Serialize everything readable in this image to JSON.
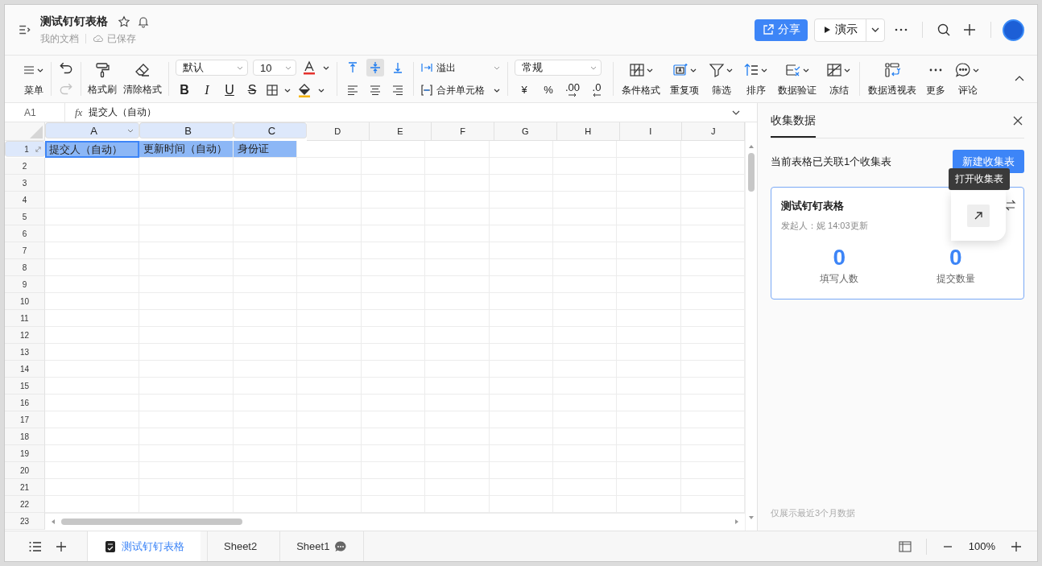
{
  "header": {
    "title": "测试钉钉表格",
    "location": "我的文档",
    "save_status": "已保存",
    "share": "分享",
    "present": "演示"
  },
  "toolbar": {
    "menu": "菜单",
    "history": [
      {
        "kind": "undo",
        "disabled": false
      },
      {
        "kind": "redo",
        "disabled": true
      }
    ],
    "format_painter": "格式刷",
    "clear_format": "清除格式",
    "font": "默认",
    "font_size": "10",
    "text_styles": [
      {
        "kind": "bold",
        "label": "B"
      },
      {
        "kind": "italic",
        "label": "I"
      },
      {
        "kind": "underline",
        "label": "U"
      },
      {
        "kind": "strike",
        "label": "S"
      }
    ],
    "vertical_align": [
      {
        "kind": "top",
        "selected": false
      },
      {
        "kind": "middle",
        "selected": true
      },
      {
        "kind": "bottom",
        "selected": false
      }
    ],
    "overflow": "溢出",
    "merge": "合并单元格",
    "number_format": "常规",
    "number_buttons": [
      {
        "kind": "plain",
        "label": "¥"
      },
      {
        "kind": "plain",
        "label": "%"
      },
      {
        "kind": "increase",
        "label": ".00"
      },
      {
        "kind": "decrease",
        "label": ".0"
      }
    ],
    "tools": [
      {
        "kind": "conditional",
        "label": "条件格式",
        "dropdown": true
      },
      {
        "kind": "duplicate",
        "label": "重复项",
        "dropdown": true
      },
      {
        "kind": "filter",
        "label": "筛选",
        "dropdown": true
      },
      {
        "kind": "sort",
        "label": "排序",
        "dropdown": true
      },
      {
        "kind": "validate",
        "label": "数据验证",
        "dropdown": true
      },
      {
        "kind": "freeze",
        "label": "冻结",
        "dropdown": true
      },
      {
        "kind": "pivot",
        "label": "数据透视表",
        "dropdown": false
      },
      {
        "kind": "more",
        "label": "更多",
        "dropdown": false
      },
      {
        "kind": "comment",
        "label": "评论",
        "dropdown": true
      }
    ]
  },
  "formula_bar": {
    "cell": "A1",
    "function_label": "fx",
    "value": "提交人（自动）"
  },
  "sheet": {
    "columns": [
      {
        "label": "A",
        "selected": true,
        "has_menu": true
      },
      {
        "label": "B",
        "selected": true,
        "has_menu": false
      },
      {
        "label": "C",
        "selected": true,
        "has_menu": false
      },
      {
        "label": "D",
        "selected": false,
        "has_menu": false
      },
      {
        "label": "E",
        "selected": false,
        "has_menu": false
      },
      {
        "label": "F",
        "selected": false,
        "has_menu": false
      },
      {
        "label": "G",
        "selected": false,
        "has_menu": false
      },
      {
        "label": "H",
        "selected": false,
        "has_menu": false
      },
      {
        "label": "I",
        "selected": false,
        "has_menu": false
      },
      {
        "label": "J",
        "selected": false,
        "has_menu": false
      }
    ],
    "rows": [
      {
        "label": "1",
        "selected": true
      },
      {
        "label": "2",
        "selected": false
      },
      {
        "label": "3",
        "selected": false
      },
      {
        "label": "4",
        "selected": false
      },
      {
        "label": "5",
        "selected": false
      },
      {
        "label": "6",
        "selected": false
      },
      {
        "label": "7",
        "selected": false
      },
      {
        "label": "8",
        "selected": false
      },
      {
        "label": "9",
        "selected": false
      },
      {
        "label": "10",
        "selected": false
      },
      {
        "label": "11",
        "selected": false
      },
      {
        "label": "12",
        "selected": false
      },
      {
        "label": "13",
        "selected": false
      },
      {
        "label": "14",
        "selected": false
      },
      {
        "label": "15",
        "selected": false
      },
      {
        "label": "16",
        "selected": false
      },
      {
        "label": "17",
        "selected": false
      },
      {
        "label": "18",
        "selected": false
      },
      {
        "label": "19",
        "selected": false
      },
      {
        "label": "20",
        "selected": false
      },
      {
        "label": "21",
        "selected": false
      },
      {
        "label": "22",
        "selected": false
      },
      {
        "label": "23",
        "selected": false
      }
    ],
    "cells": [
      {
        "text": "提交人（自动）",
        "selected": true,
        "active": true
      },
      {
        "text": "更新时间（自动）",
        "selected": true,
        "active": false
      },
      {
        "text": "身份证",
        "selected": true,
        "active": false
      }
    ]
  },
  "panel": {
    "tab": "收集数据",
    "summary": "当前表格已关联1个收集表",
    "new_button": "新建收集表",
    "tooltip": "打开收集表",
    "card": {
      "title": "测试钉钉表格",
      "meta": "发起人：妮  14:03更新",
      "stats": [
        {
          "value": "0",
          "label": "填写人数"
        },
        {
          "value": "0",
          "label": "提交数量"
        }
      ]
    },
    "note": "仅展示最近3个月数据"
  },
  "sheet_tabs": [
    {
      "kind": "form",
      "label": "测试钉钉表格",
      "selected": true
    },
    {
      "kind": "plain",
      "label": "Sheet2",
      "selected": false
    },
    {
      "kind": "comment",
      "label": "Sheet1",
      "selected": false
    }
  ],
  "zoom": "100%"
}
